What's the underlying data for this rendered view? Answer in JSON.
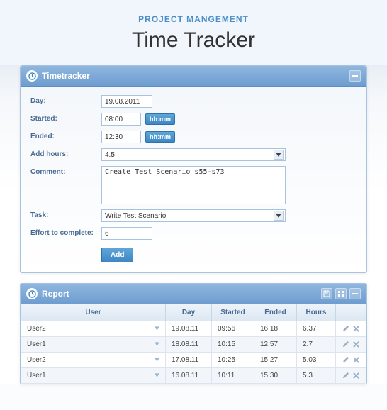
{
  "header": {
    "subtitle": "PROJECT MANGEMENT",
    "title": "Time Tracker"
  },
  "tracker": {
    "panel_title": "Timetracker",
    "labels": {
      "day": "Day:",
      "started": "Started:",
      "ended": "Ended:",
      "add_hours": "Add hours:",
      "comment": "Comment:",
      "task": "Task:",
      "effort": "Effort to complete:"
    },
    "values": {
      "day": "19.08.2011",
      "started": "08:00",
      "ended": "12:30",
      "add_hours": "4.5",
      "comment": "Create Test Scenario s55-s73",
      "task": "Write Test Scenario",
      "effort": "6"
    },
    "hhmm_label": "hh:mm",
    "add_label": "Add"
  },
  "report": {
    "panel_title": "Report",
    "columns": {
      "user": "User",
      "day": "Day",
      "started": "Started",
      "ended": "Ended",
      "hours": "Hours"
    },
    "rows": [
      {
        "user": "User2",
        "day": "19.08.11",
        "started": "09:56",
        "ended": "16:18",
        "hours": "6.37"
      },
      {
        "user": "User1",
        "day": "18.08.11",
        "started": "10:15",
        "ended": "12:57",
        "hours": "2.7"
      },
      {
        "user": "User2",
        "day": "17.08.11",
        "started": "10:25",
        "ended": "15:27",
        "hours": "5.03"
      },
      {
        "user": "User1",
        "day": "16.08.11",
        "started": "10:11",
        "ended": "15:30",
        "hours": "5.3"
      }
    ]
  }
}
